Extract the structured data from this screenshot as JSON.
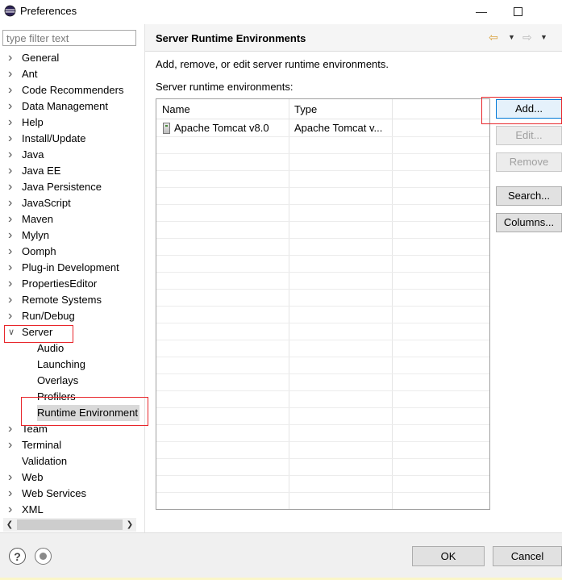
{
  "window": {
    "title": "Preferences",
    "minimize_glyph": "—",
    "maximize_glyph": "□"
  },
  "filter": {
    "placeholder": "type filter text",
    "value": ""
  },
  "tree": {
    "items": [
      {
        "label": "General",
        "expanded": false
      },
      {
        "label": "Ant",
        "expanded": false
      },
      {
        "label": "Code Recommenders",
        "expanded": false
      },
      {
        "label": "Data Management",
        "expanded": false
      },
      {
        "label": "Help",
        "expanded": false
      },
      {
        "label": "Install/Update",
        "expanded": false
      },
      {
        "label": "Java",
        "expanded": false
      },
      {
        "label": "Java EE",
        "expanded": false
      },
      {
        "label": "Java Persistence",
        "expanded": false
      },
      {
        "label": "JavaScript",
        "expanded": false
      },
      {
        "label": "Maven",
        "expanded": false
      },
      {
        "label": "Mylyn",
        "expanded": false
      },
      {
        "label": "Oomph",
        "expanded": false
      },
      {
        "label": "Plug-in Development",
        "expanded": false
      },
      {
        "label": "PropertiesEditor",
        "expanded": false
      },
      {
        "label": "Remote Systems",
        "expanded": false
      },
      {
        "label": "Run/Debug",
        "expanded": false
      },
      {
        "label": "Server",
        "expanded": true
      },
      {
        "label": "Team",
        "expanded": false
      },
      {
        "label": "Terminal",
        "expanded": false
      },
      {
        "label": "Validation",
        "expanded": null
      },
      {
        "label": "Web",
        "expanded": false
      },
      {
        "label": "Web Services",
        "expanded": false
      },
      {
        "label": "XML",
        "expanded": false
      }
    ],
    "server_children": [
      "Audio",
      "Launching",
      "Overlays",
      "Profilers",
      "Runtime Environment"
    ],
    "selected": "Runtime Environment"
  },
  "page": {
    "title": "Server Runtime Environments",
    "description": "Add, remove, or edit server runtime environments.",
    "list_label": "Server runtime environments:"
  },
  "table": {
    "columns": [
      "Name",
      "Type"
    ],
    "rows": [
      {
        "name": "Apache Tomcat v8.0",
        "type": "Apache Tomcat v..."
      }
    ]
  },
  "buttons": {
    "add": "Add...",
    "edit": "Edit...",
    "remove": "Remove",
    "search": "Search...",
    "columns": "Columns..."
  },
  "footer": {
    "ok": "OK",
    "cancel": "Cancel",
    "help_glyph": "?"
  },
  "colors": {
    "annotation_red": "#e8262b",
    "selection": "#d9d9d9",
    "back_arrow": "#d9a03a"
  },
  "icons": {
    "app": "eclipse-icon",
    "help": "help-icon",
    "record": "record-macro-icon",
    "back": "back-arrow-icon",
    "forward": "forward-arrow-icon",
    "server": "server-runtime-icon"
  }
}
